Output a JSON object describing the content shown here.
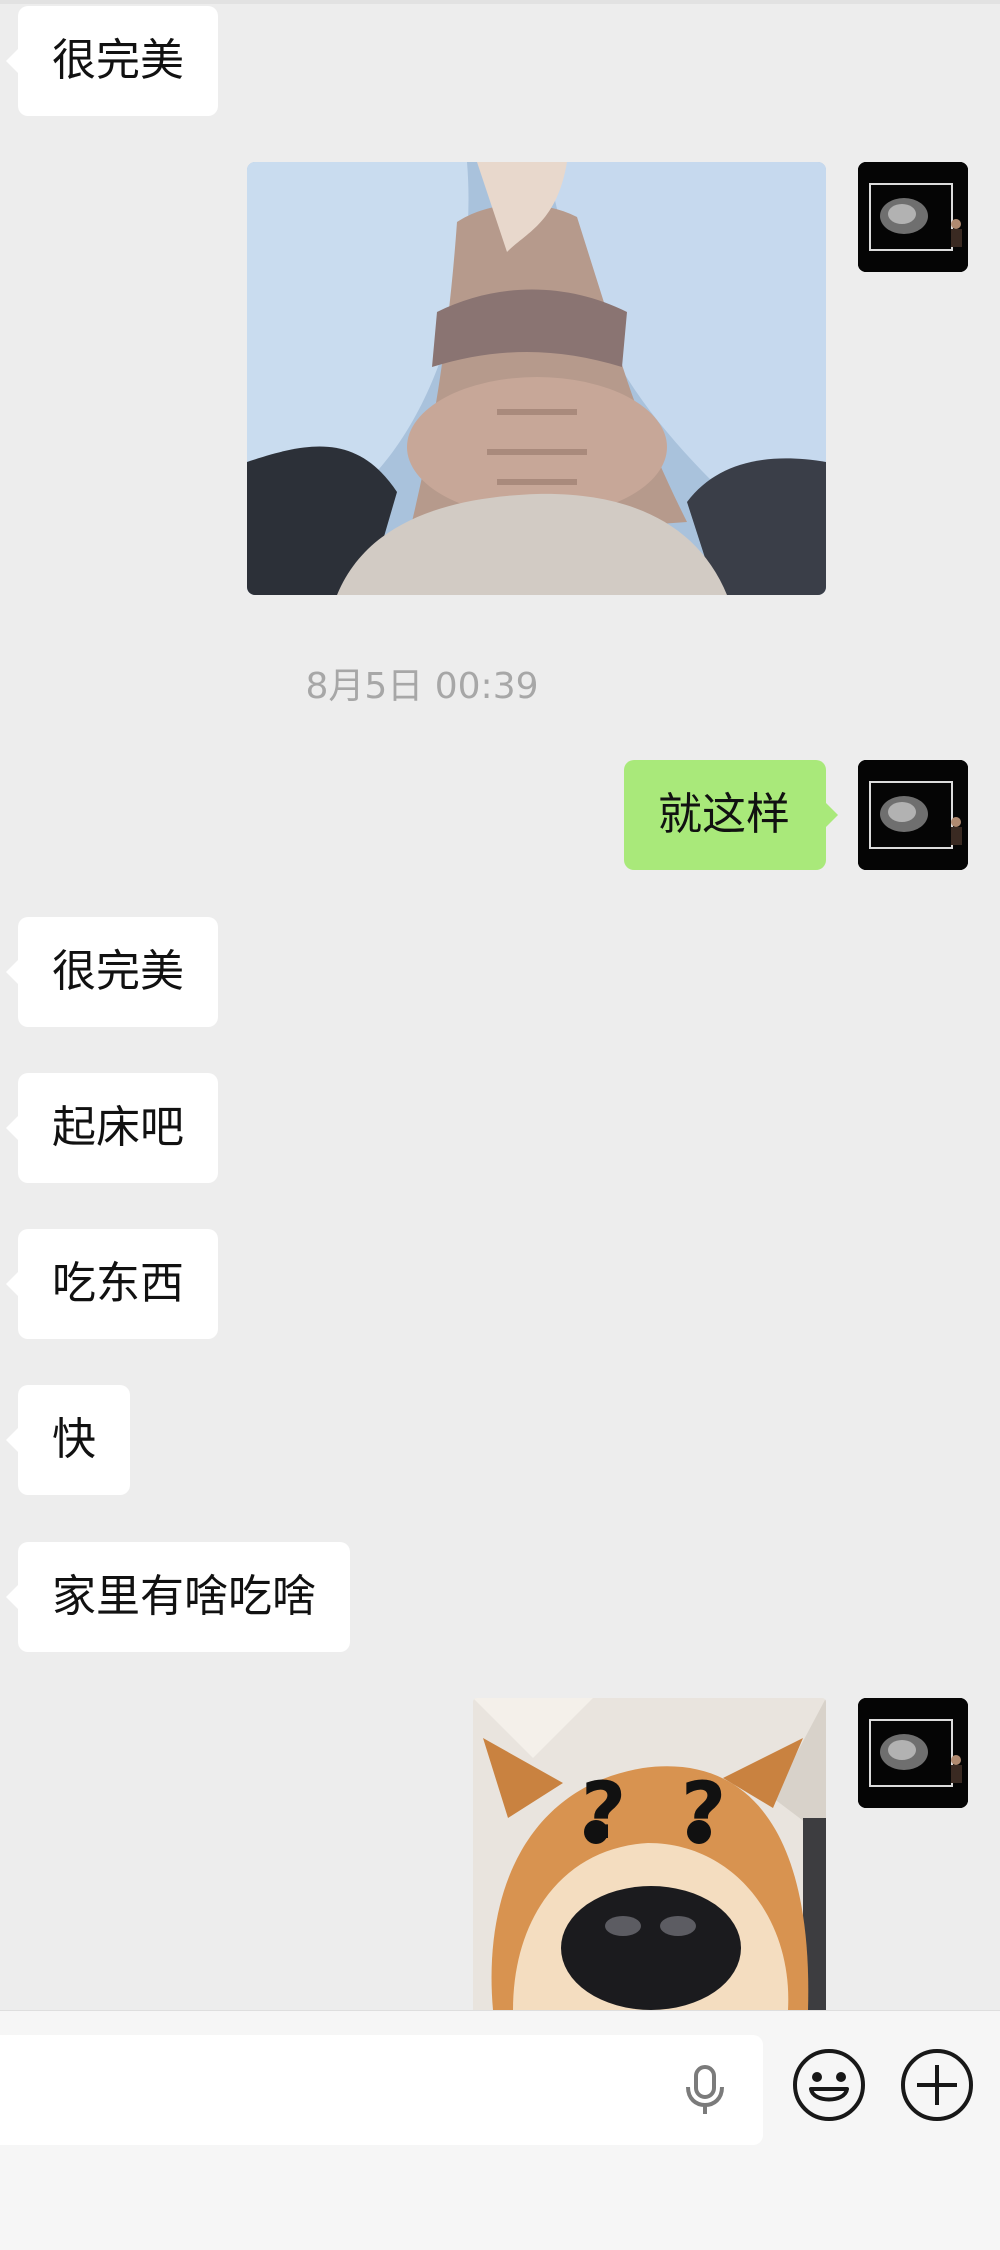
{
  "messages": [
    {
      "side": "received",
      "type": "text",
      "text": "很完美"
    },
    {
      "side": "sent",
      "type": "image",
      "image": "photo-under-blanket"
    },
    {
      "side": "system",
      "type": "timestamp",
      "text": "8月5日 00:39"
    },
    {
      "side": "sent",
      "type": "text",
      "text": "就这样"
    },
    {
      "side": "received",
      "type": "text",
      "text": "很完美"
    },
    {
      "side": "received",
      "type": "text",
      "text": "起床吧"
    },
    {
      "side": "received",
      "type": "text",
      "text": "吃东西"
    },
    {
      "side": "received",
      "type": "text",
      "text": "快"
    },
    {
      "side": "received",
      "type": "text",
      "text": "家里有啥吃啥"
    },
    {
      "side": "sent",
      "type": "image",
      "image": "shiba-dog-question-sticker"
    }
  ],
  "input_bar": {
    "message_value": "",
    "icons": [
      "microphone-icon",
      "emoji-icon",
      "plus-icon"
    ]
  },
  "colors": {
    "background": "#ededed",
    "received_bubble": "#ffffff",
    "sent_bubble": "#a9e97a",
    "timestamp_text": "#a7a7a7"
  }
}
